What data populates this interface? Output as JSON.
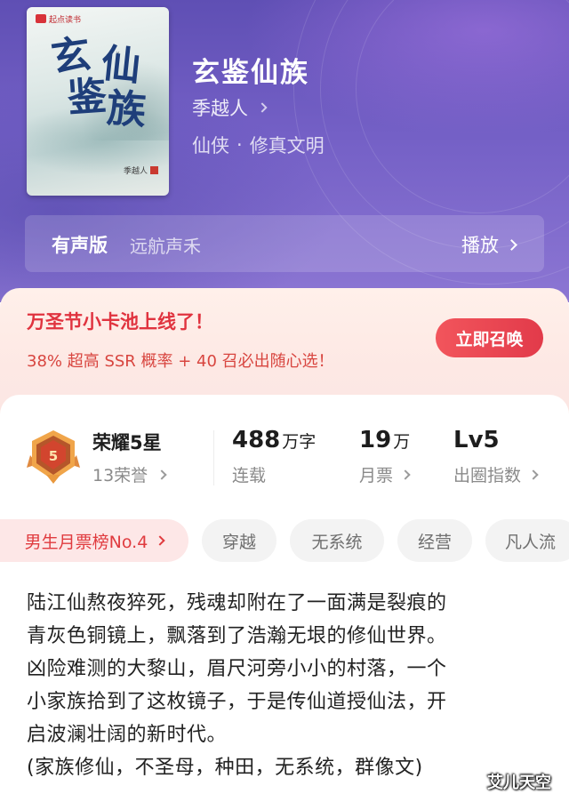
{
  "book": {
    "cover": {
      "badge": "起点读书",
      "title_chars": [
        "玄",
        "仙",
        "鉴",
        "族"
      ],
      "author": "季越人"
    },
    "title": "玄鉴仙族",
    "author": "季越人",
    "genre": "仙侠",
    "subgenre": "修真文明",
    "genre_separator": "·"
  },
  "audio": {
    "label": "有声版",
    "narrator": "远航声禾",
    "action": "播放"
  },
  "promo": {
    "title": "万圣节小卡池上线了！",
    "description": "38% 超高 SSR 概率 + 40 召必出随心选！",
    "button": "立即召唤"
  },
  "honor": {
    "medal_level": "5",
    "title": "荣耀5星",
    "subtitle": "13荣誉"
  },
  "stats": [
    {
      "value": "488",
      "unit": "万字",
      "label": "连载"
    },
    {
      "value": "19",
      "unit": "万",
      "label": "月票"
    },
    {
      "value": "Lv5",
      "unit": "",
      "label": "出圈指数"
    }
  ],
  "tags": {
    "rank": "男生月票榜No.4",
    "items": [
      "穿越",
      "无系统",
      "经营",
      "凡人流"
    ]
  },
  "synopsis": [
    "陆江仙熬夜猝死，残魂却附在了一面满是裂痕的",
    "青灰色铜镜上，飘落到了浩瀚无垠的修仙世界。",
    "凶险难测的大黎山，眉尺河旁小小的村落，一个",
    "小家族拾到了这枚镜子，于是传仙道授仙法，开",
    "启波澜壮阔的新时代。",
    "(家族修仙，不圣母，种田，无系统，群像文)"
  ],
  "watermark": "艾儿天空",
  "colors": {
    "hero_purple": "#6f5cc2",
    "accent_red": "#e0333f",
    "promo_bg": "#fdeae5"
  }
}
